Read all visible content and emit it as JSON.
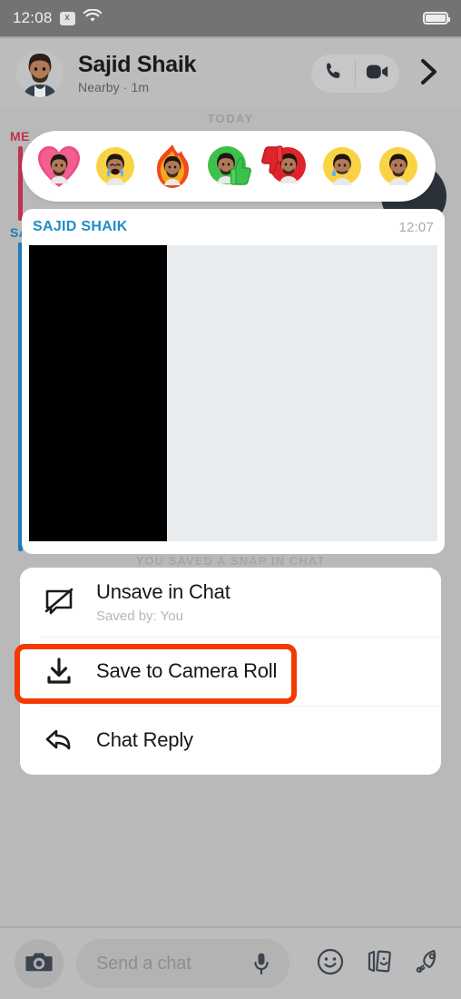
{
  "status_bar": {
    "time": "12:08",
    "x_badge": "x",
    "wifi_icon": "wifi-icon",
    "battery_icon": "battery-icon"
  },
  "header": {
    "avatar_icon": "bitmoji-avatar",
    "name": "Sajid Shaik",
    "subtitle": "Nearby · 1m",
    "call_icon": "phone-icon",
    "video_icon": "video-camera-icon",
    "chevron_icon": "chevron-right-icon"
  },
  "conversation": {
    "date_divider": "TODAY",
    "rails": [
      {
        "label": "ME",
        "color": "#c0334d"
      },
      {
        "label": "SAJID",
        "color": "#1e7bb8"
      }
    ],
    "reactions": [
      {
        "name": "heart-bitmoji-reaction",
        "emoji": "❤"
      },
      {
        "name": "crying-bitmoji-reaction",
        "emoji": "😭"
      },
      {
        "name": "fire-bitmoji-reaction",
        "emoji": "🔥"
      },
      {
        "name": "thumbs-up-bitmoji-reaction",
        "emoji": "👍"
      },
      {
        "name": "thumbs-down-bitmoji-reaction",
        "emoji": "👎"
      },
      {
        "name": "sweat-bitmoji-reaction",
        "emoji": "😅"
      },
      {
        "name": "neutral-bitmoji-reaction",
        "emoji": "😐"
      }
    ],
    "snap": {
      "sender": "SAJID SHAIK",
      "time": "12:07"
    },
    "saved_status": "YOU SAVED A SNAP IN CHAT"
  },
  "action_sheet": {
    "items": [
      {
        "icon": "unsave-chat-icon",
        "title": "Unsave in Chat",
        "subtitle": "Saved by: You",
        "highlighted": false
      },
      {
        "icon": "download-icon",
        "title": "Save to Camera Roll",
        "subtitle": "",
        "highlighted": true
      },
      {
        "icon": "reply-arrow-icon",
        "title": "Chat Reply",
        "subtitle": "",
        "highlighted": false
      }
    ],
    "highlight_color": "#f53800"
  },
  "bottom_bar": {
    "camera_icon": "camera-icon",
    "input_placeholder": "Send a chat",
    "mic_icon": "microphone-icon",
    "sticker_icon": "smiley-sticker-icon",
    "cards_icon": "sticker-cards-icon",
    "rocket_icon": "rocket-icon"
  }
}
